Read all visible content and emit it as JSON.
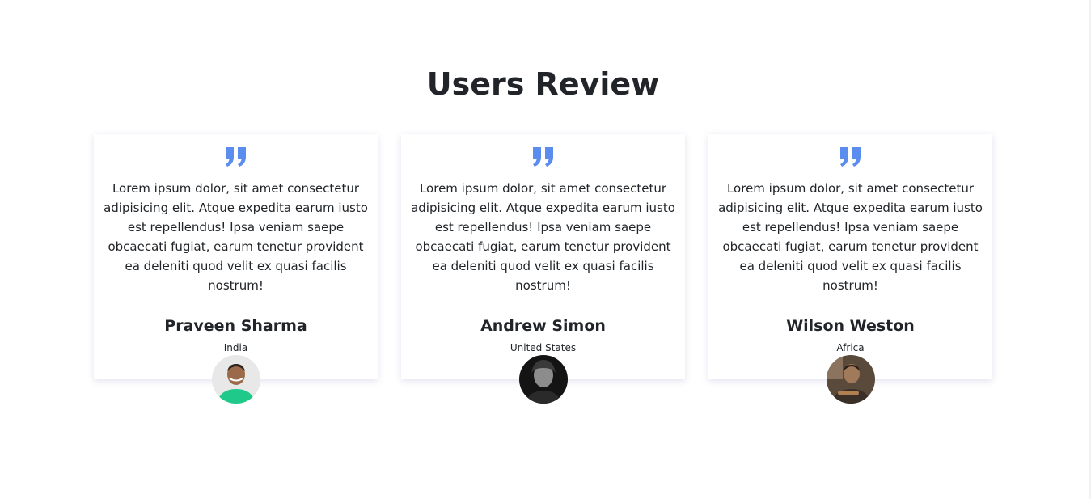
{
  "section": {
    "title": "Users Review"
  },
  "reviews": [
    {
      "text": "Lorem ipsum dolor, sit amet consectetur adipisicing elit. Atque expedita earum iusto est repellendus! Ipsa veniam saepe obcaecati fugiat, earum tenetur provident ea deleniti quod velit ex quasi facilis nostrum!",
      "name": "Praveen Sharma",
      "location": "India"
    },
    {
      "text": "Lorem ipsum dolor, sit amet consectetur adipisicing elit. Atque expedita earum iusto est repellendus! Ipsa veniam saepe obcaecati fugiat, earum tenetur provident ea deleniti quod velit ex quasi facilis nostrum!",
      "name": "Andrew Simon",
      "location": "United States"
    },
    {
      "text": "Lorem ipsum dolor, sit amet consectetur adipisicing elit. Atque expedita earum iusto est repellendus! Ipsa veniam saepe obcaecati fugiat, earum tenetur provident ea deleniti quod velit ex quasi facilis nostrum!",
      "name": "Wilson Weston",
      "location": "Africa"
    }
  ],
  "colors": {
    "quote_accent": "#5b8def",
    "title_text": "#212529",
    "background": "#ffffff"
  },
  "icons": {
    "quote": "quote-icon",
    "avatar": "avatar-photo"
  }
}
